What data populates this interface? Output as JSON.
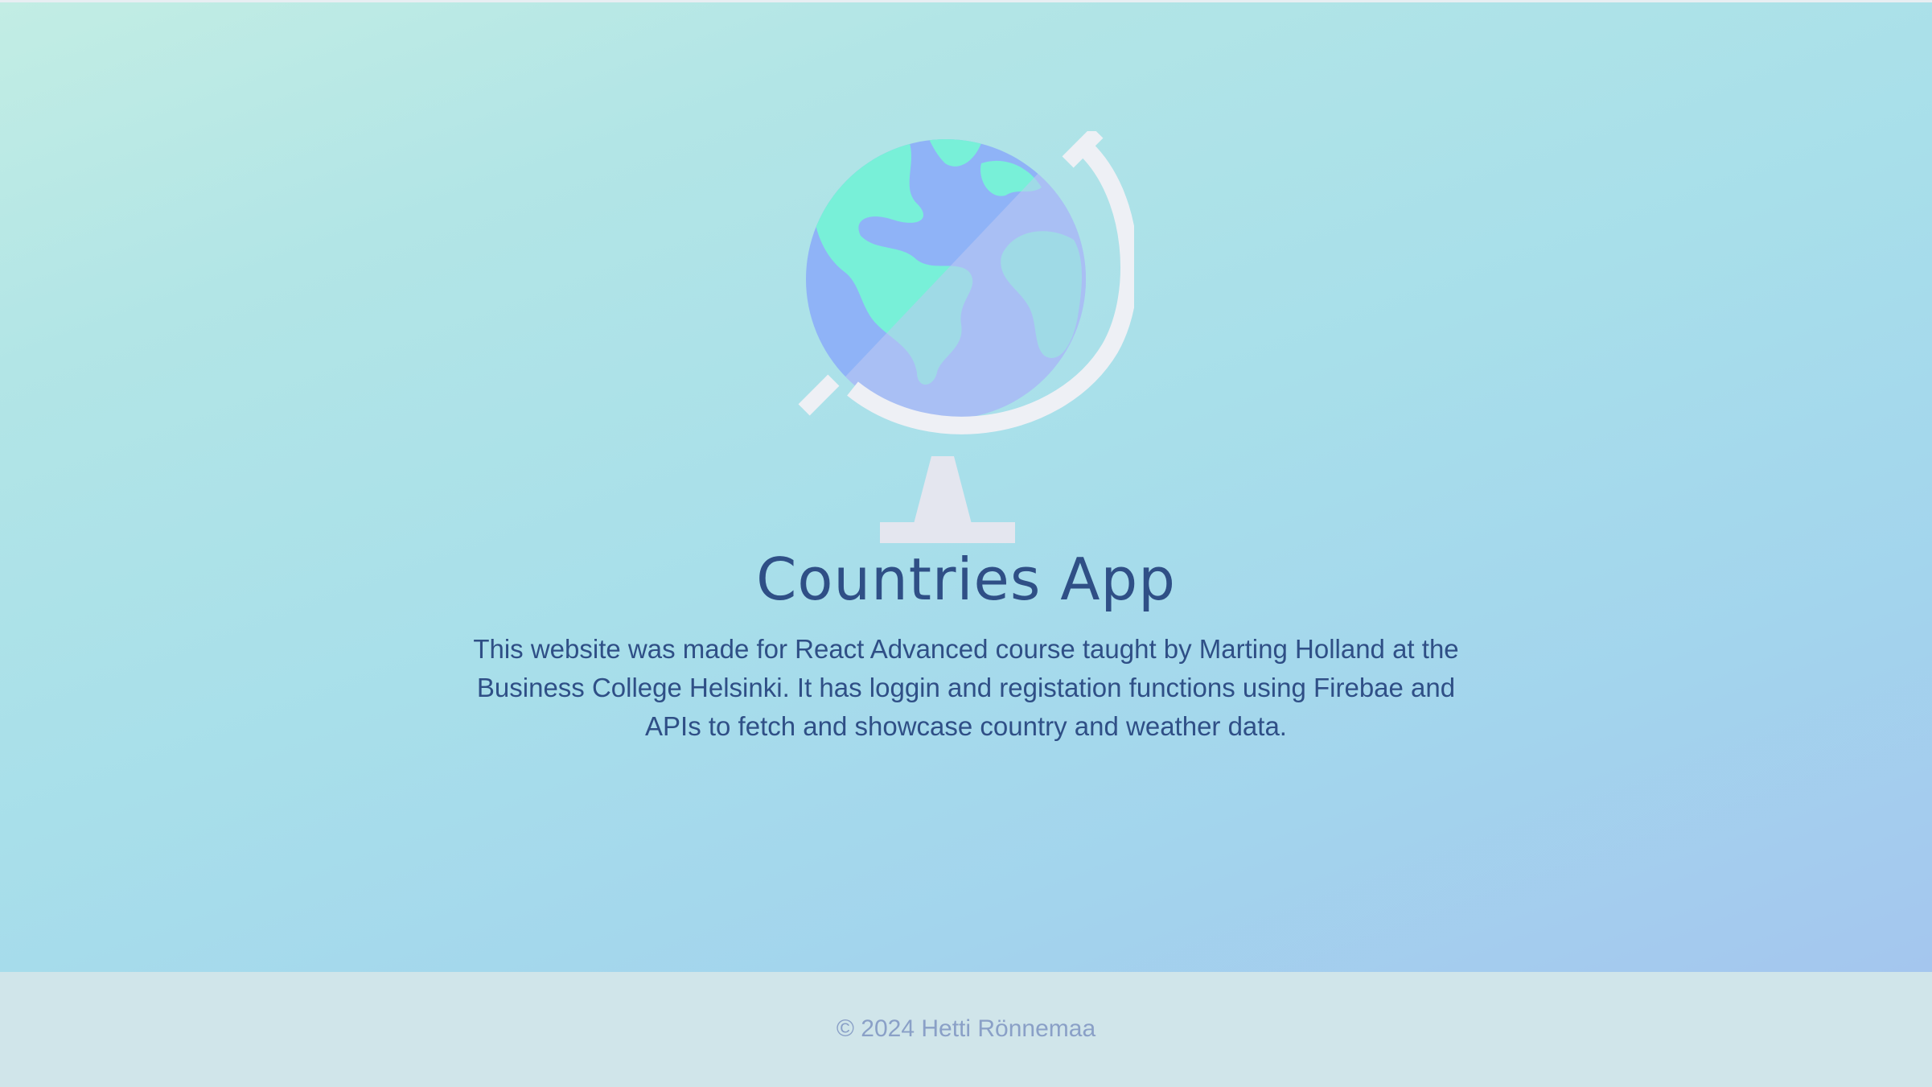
{
  "hero": {
    "icon": "globe-icon",
    "title": "Countries App",
    "description": "This website was made for React Advanced course taught by Marting Holland at the Business College Helsinki. It has loggin and registation functions using Firebae and APIs to fetch and showcase country and weather data."
  },
  "footer": {
    "copyright": "© 2024 Hetti Rönnemaa"
  },
  "colors": {
    "text_primary": "#2f4f86",
    "footer_text": "#8aa0c7",
    "footer_bg": "#d0e5ea",
    "ocean": "#8fb3f7",
    "land": "#78f0d8",
    "stand": "#eef0f5"
  }
}
